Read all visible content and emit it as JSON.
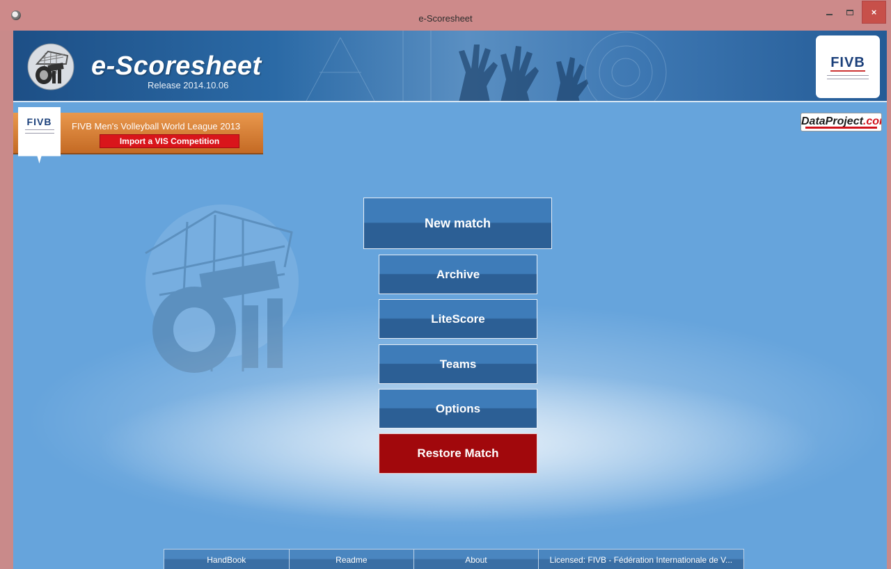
{
  "window": {
    "title": "e-Scoresheet",
    "close_glyph": "×"
  },
  "header": {
    "app_name": "e-Scoresheet",
    "release": "Release 2014.10.06",
    "fivb_logo_text": "FIVB"
  },
  "competition": {
    "badge_text": "FIVB",
    "title": "FIVB Men's Volleyball World League 2013",
    "import_label": "Import a VIS Competition"
  },
  "dataproject": {
    "part_a": "DataProject",
    "part_b": ".com"
  },
  "menu": {
    "new_match": "New match",
    "archive": "Archive",
    "litescore": "LiteScore",
    "teams": "Teams",
    "options": "Options",
    "restore_match": "Restore Match"
  },
  "footer": {
    "handbook": "HandBook",
    "readme": "Readme",
    "about": "About",
    "license": "Licensed: FIVB - Fédération Internationale de V..."
  },
  "colors": {
    "title_bar": "#cd8a8a",
    "background": "#66a4dc",
    "menu_button": "#3e7cb9",
    "restore_button": "#a1080c",
    "import_button": "#d9151b"
  },
  "icons": {
    "app": "whistle-icon",
    "minimize": "minimize-icon",
    "maximize": "maximize-icon",
    "close": "close-icon"
  }
}
